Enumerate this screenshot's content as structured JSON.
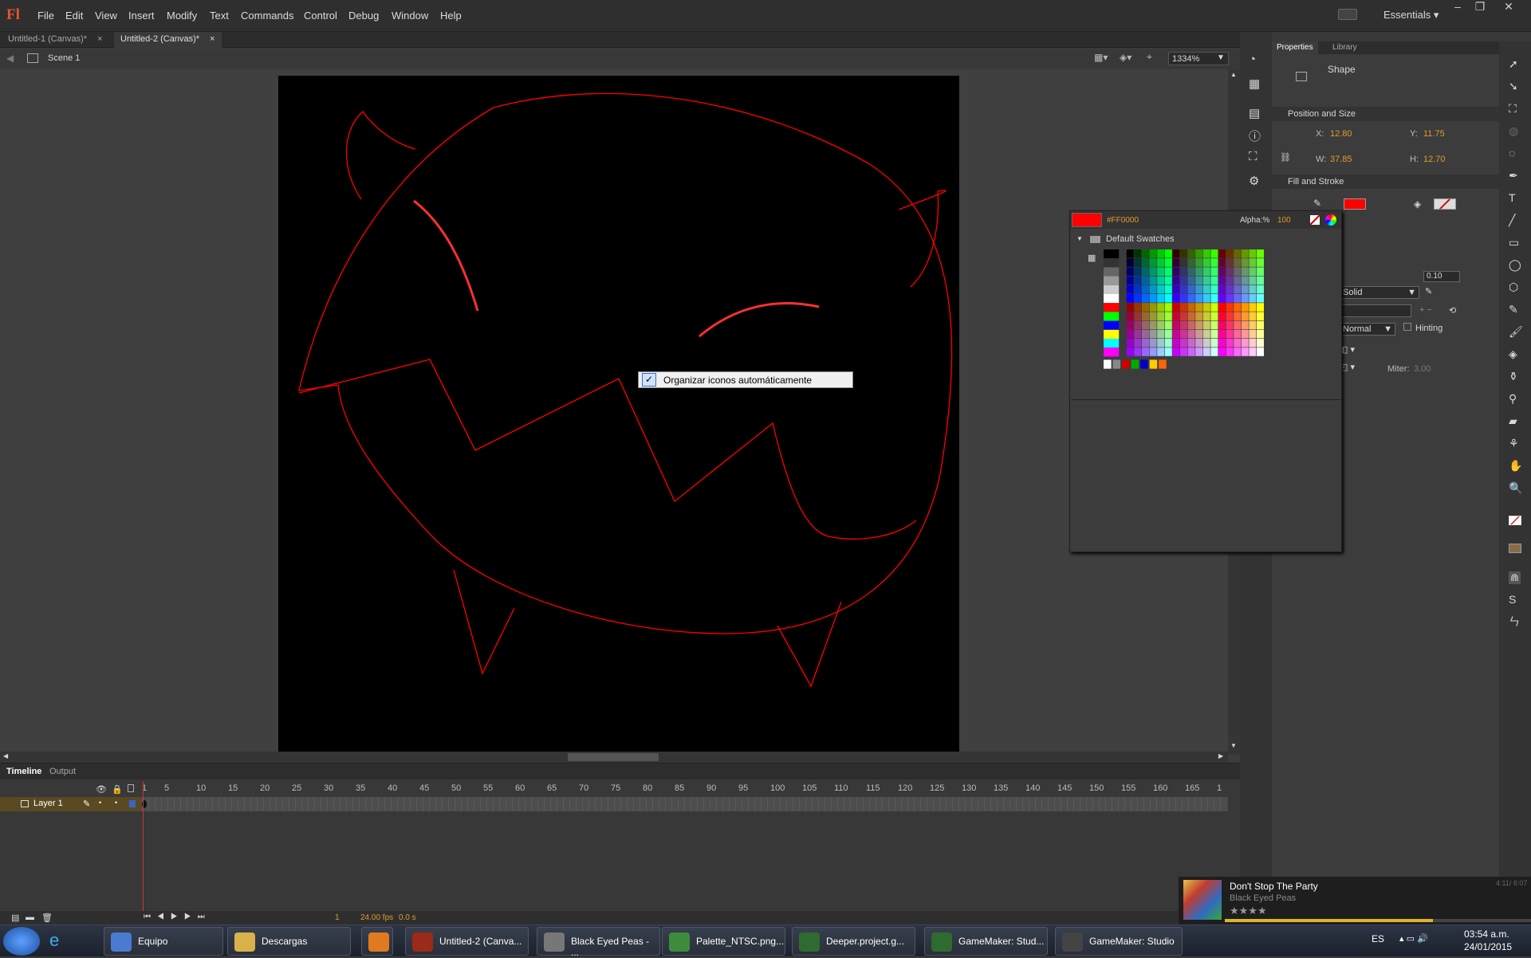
{
  "app": {
    "logo": "Fl",
    "workspace": "Essentials"
  },
  "menu": [
    "File",
    "Edit",
    "View",
    "Insert",
    "Modify",
    "Text",
    "Commands",
    "Control",
    "Debug",
    "Window",
    "Help"
  ],
  "tabs": [
    {
      "label": "Untitled-1 (Canvas)*"
    },
    {
      "label": "Untitled-2 (Canvas)*"
    }
  ],
  "scene": {
    "label": "Scene 1",
    "zoom": "1334%"
  },
  "stage": {
    "stroke_color": "#ff0000",
    "background": "#000000"
  },
  "properties": {
    "tabs": [
      "Properties",
      "Library"
    ],
    "object_type": "Shape",
    "position_size": {
      "title": "Position and Size",
      "x_label": "X:",
      "x": "12.80",
      "y_label": "Y:",
      "y": "11.75",
      "w_label": "W:",
      "w": "37.85",
      "h_label": "H:",
      "h": "12.70"
    },
    "fill_stroke": {
      "title": "Fill and Stroke",
      "fill_color": "#ff0000"
    },
    "stroke_size": "0.10",
    "style": "Solid",
    "scale": "Normal",
    "hinting": "Hinting",
    "miter_label": "Miter:",
    "miter": "3.00"
  },
  "swatches": {
    "hex": "#FF0000",
    "alpha_label": "Alpha:%",
    "alpha": "100",
    "folder": "Default Swatches"
  },
  "context_menu": {
    "item": "Organizar iconos automáticamente",
    "checked": "✓"
  },
  "timeline": {
    "tabs": [
      "Timeline",
      "Output"
    ],
    "layer": "Layer 1",
    "frame_numbers": [
      "1",
      "5",
      "10",
      "15",
      "20",
      "25",
      "30",
      "35",
      "40",
      "45",
      "50",
      "55",
      "60",
      "65",
      "70",
      "75",
      "80",
      "85",
      "90",
      "95",
      "100",
      "105",
      "110",
      "115",
      "120",
      "125",
      "130",
      "135",
      "140",
      "145",
      "150",
      "155",
      "160",
      "165",
      "1"
    ],
    "current_frame": "1",
    "fps": "24.00 fps",
    "time": "0.0 s"
  },
  "taskbar": {
    "items": [
      {
        "label": "Equipo",
        "color": "#4a7bd0"
      },
      {
        "label": "Descargas",
        "color": "#d9b14a"
      },
      {
        "label": "",
        "color": "#e07a20"
      },
      {
        "label": "Untitled-2 (Canva...",
        "color": "#9b2a18"
      },
      {
        "label": "Black Eyed Peas - ...",
        "color": "#777777"
      },
      {
        "label": "Palette_NTSC.png...",
        "color": "#3d8b3d"
      },
      {
        "label": "Deeper.project.g...",
        "color": "#2f6b2f"
      },
      {
        "label": "GameMaker: Stud...",
        "color": "#2f6b2f"
      },
      {
        "label": "GameMaker: Studio",
        "color": "#444444"
      }
    ],
    "lang": "ES",
    "time": "03:54 a.m.",
    "date": "24/01/2015"
  },
  "player": {
    "title": "Don't Stop The Party",
    "artist": "Black Eyed Peas",
    "time": "4:11/ 6:07",
    "rating": "★★★★"
  }
}
